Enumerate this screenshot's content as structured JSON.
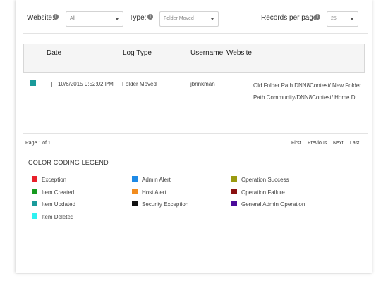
{
  "filters": {
    "website_label": "Website:",
    "website_value": "All",
    "type_label": "Type:",
    "type_value": "Folder Moved",
    "records_label": "Records per page:",
    "records_value": "25"
  },
  "table": {
    "columns": [
      "Date",
      "Log Type",
      "Username",
      "Website"
    ],
    "rows": [
      {
        "color": "#1a9a9a",
        "date": "10/6/2015 9:52:02 PM",
        "log_type": "Folder Moved",
        "username": "jbrinkman",
        "website": "Old Folder Path DNN8Contest/ New Folder Path Community/DNN8Contest/ Home D"
      }
    ]
  },
  "pager": {
    "status": "Page 1 of 1",
    "first": "First",
    "previous": "Previous",
    "next": "Next",
    "last": "Last"
  },
  "legend": {
    "title": "COLOR CODING LEGEND",
    "items": [
      {
        "label": "Exception",
        "color": "#e8202a"
      },
      {
        "label": "Item Created",
        "color": "#169a1f"
      },
      {
        "label": "Item Updated",
        "color": "#1a9a9a"
      },
      {
        "label": "Item Deleted",
        "color": "#2ef2f2"
      },
      {
        "label": "Admin Alert",
        "color": "#1e8ae6"
      },
      {
        "label": "Host Alert",
        "color": "#f28c1e"
      },
      {
        "label": "Security Exception",
        "color": "#111111"
      },
      {
        "label": "Operation Success",
        "color": "#9a9a10"
      },
      {
        "label": "Operation Failure",
        "color": "#8a1010"
      },
      {
        "label": "General Admin Operation",
        "color": "#4b0a9a"
      }
    ]
  }
}
